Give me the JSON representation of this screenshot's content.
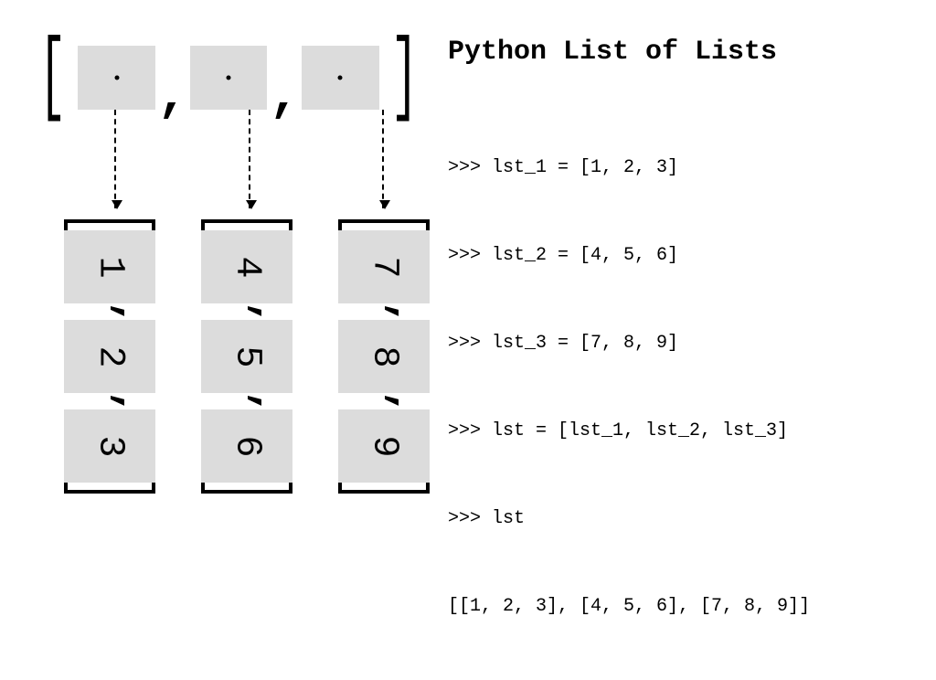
{
  "title": "Python List of Lists",
  "code_lines": [
    ">>> lst_1 = [1, 2, 3]",
    ">>> lst_2 = [4, 5, 6]",
    ">>> lst_3 = [7, 8, 9]",
    ">>> lst = [lst_1, lst_2, lst_3]",
    ">>> lst",
    "[[1, 2, 3], [4, 5, 6], [7, 8, 9]]"
  ],
  "outer_list_slot_count": 3,
  "inner_lists": [
    {
      "values": [
        "1",
        "2",
        "3"
      ]
    },
    {
      "values": [
        "4",
        "5",
        "6"
      ]
    },
    {
      "values": [
        "7",
        "8",
        "9"
      ]
    }
  ],
  "brackets": {
    "open": "[",
    "close": "]",
    "comma": ","
  },
  "chart_data": {
    "type": "table",
    "title": "Python List of Lists",
    "structure": "outer list of 3 references; each reference points to an inner list of 3 integers",
    "outer": [
      "lst_1",
      "lst_2",
      "lst_3"
    ],
    "inner": [
      [
        1,
        2,
        3
      ],
      [
        4,
        5,
        6
      ],
      [
        7,
        8,
        9
      ]
    ]
  }
}
